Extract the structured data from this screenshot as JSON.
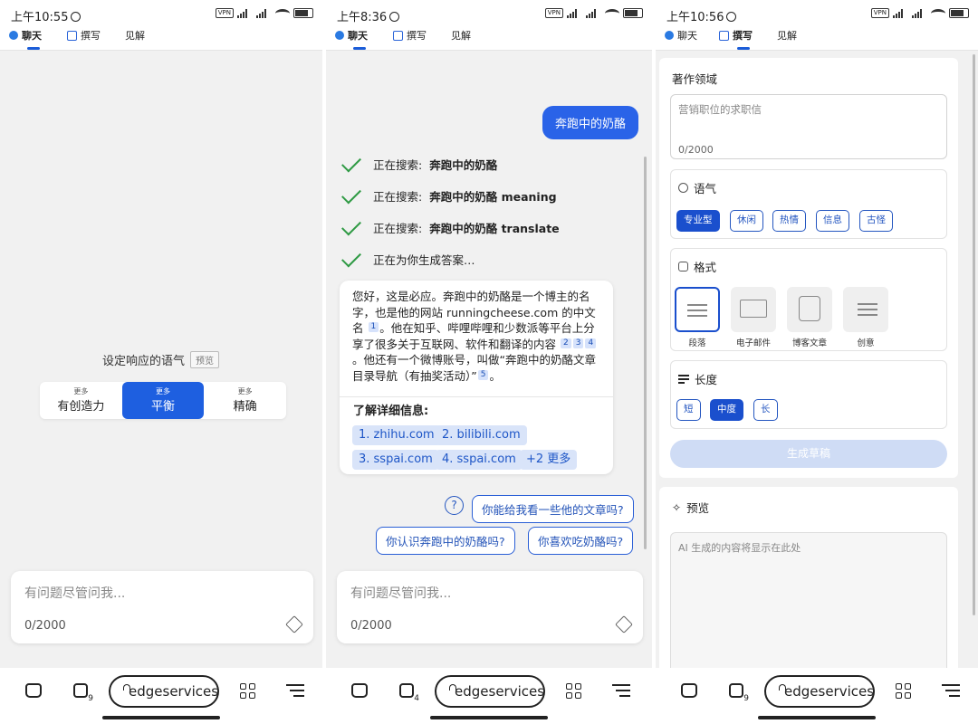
{
  "panels": [
    {
      "time": "上午10:55",
      "tab_count": "9"
    },
    {
      "time": "上午8:36",
      "tab_count": "4"
    },
    {
      "time": "上午10:56",
      "tab_count": "9"
    }
  ],
  "status": {
    "vpn": "VPN"
  },
  "tabs": {
    "chat": "聊天",
    "compose": "撰写",
    "insights": "见解"
  },
  "address": "edgeservices",
  "input": {
    "placeholder": "有问题尽管问我...",
    "counter": "0/2000"
  },
  "panel1": {
    "tone_label": "设定响应的语气",
    "preview_badge": "预览",
    "tones": [
      {
        "more": "更多",
        "label": "有创造力"
      },
      {
        "more": "更多",
        "label": "平衡"
      },
      {
        "more": "更多",
        "label": "精确"
      }
    ]
  },
  "panel2": {
    "question": "奔跑中的奶酪",
    "steps": [
      {
        "prefix": "正在搜索: ",
        "query": "奔跑中的奶酪"
      },
      {
        "prefix": "正在搜索: ",
        "query": "奔跑中的奶酪 meaning"
      },
      {
        "prefix": "正在搜索: ",
        "query": "奔跑中的奶酪 translate"
      },
      {
        "prefix": "正在为你生成答案…",
        "query": ""
      }
    ],
    "answer": {
      "t1": "您好，这是必应。奔跑中的奶酪是一个博主的名字，也是他的网站 runningcheese.com 的中文名",
      "t2": "。他在知乎、哔哩哔哩和少数派等平台上分享了很多关于互联网、软件和翻译的内容",
      "t3": "。他还有一个微博账号，叫做“奔跑中的奶酪文章目录导航（有抽奖活动）”",
      "t4": "。",
      "c1": "1",
      "c2": "2",
      "c3": "3",
      "c4": "4",
      "c5": "5"
    },
    "learn_more": "了解详细信息:",
    "links": [
      "1. zhihu.com",
      "2. bilibili.com",
      "3. sspai.com",
      "4. sspai.com",
      "+2 更多"
    ],
    "help_icon": "?",
    "suggestions": [
      "你能给我看一些他的文章吗?",
      "你认识奔跑中的奶酪吗?",
      "你喜欢吃奶酪吗?"
    ]
  },
  "panel3": {
    "domain_label": "著作领域",
    "domain_placeholder": "营销职位的求职信",
    "domain_counter": "0/2000",
    "tone_label": "语气",
    "tones": [
      "专业型",
      "休闲",
      "热情",
      "信息",
      "古怪"
    ],
    "format_label": "格式",
    "formats": [
      "段落",
      "电子邮件",
      "博客文章",
      "创意"
    ],
    "length_label": "长度",
    "lengths": [
      "短",
      "中度",
      "长"
    ],
    "generate": "生成草稿",
    "preview_label": "预览",
    "preview_placeholder": "AI 生成的内容将显示在此处"
  },
  "colors": {
    "accent": "#1e5fe0",
    "check": "#2f9a44",
    "link_bg": "#d9e4f9"
  }
}
